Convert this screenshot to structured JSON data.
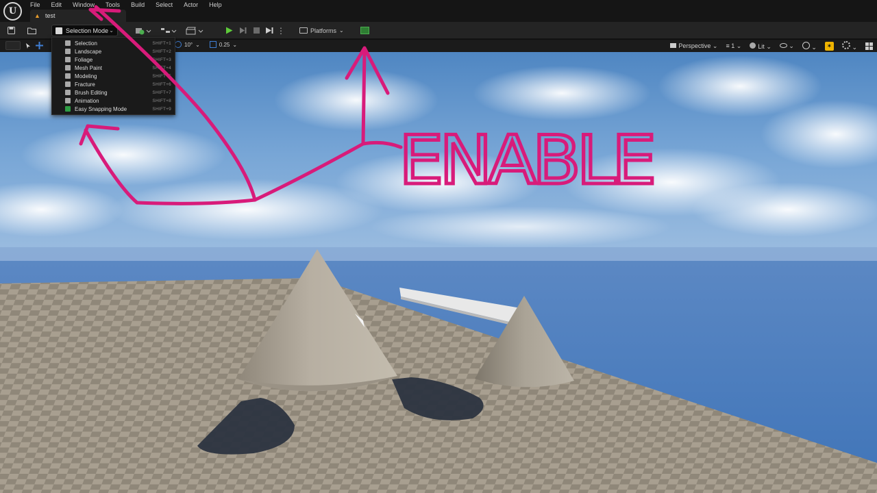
{
  "app": {
    "logo": "U",
    "menu": [
      "File",
      "Edit",
      "Window",
      "Tools",
      "Build",
      "Select",
      "Actor",
      "Help"
    ],
    "level_tab": "test"
  },
  "toolbar": {
    "mode_label": "Selection Mode",
    "platforms_label": "Platforms"
  },
  "viewport_bar": {
    "rotation_snap": "10°",
    "scale_snap": "0.25",
    "view_label": "Perspective",
    "camera_speed": "1",
    "view_mode": "Lit"
  },
  "mode_menu": {
    "items": [
      {
        "label": "Selection",
        "shortcut": "SHIFT+1",
        "icon": "selection-icon"
      },
      {
        "label": "Landscape",
        "shortcut": "SHIFT+2",
        "icon": "landscape-icon"
      },
      {
        "label": "Foliage",
        "shortcut": "SHIFT+3",
        "icon": "foliage-icon"
      },
      {
        "label": "Mesh Paint",
        "shortcut": "SHIFT+4",
        "icon": "mesh-paint-icon"
      },
      {
        "label": "Modeling",
        "shortcut": "SHIFT+5",
        "icon": "modeling-icon"
      },
      {
        "label": "Fracture",
        "shortcut": "SHIFT+6",
        "icon": "fracture-icon"
      },
      {
        "label": "Brush Editing",
        "shortcut": "SHIFT+7",
        "icon": "brush-editing-icon"
      },
      {
        "label": "Animation",
        "shortcut": "SHIFT+8",
        "icon": "animation-icon"
      },
      {
        "label": "Easy Snapping Mode",
        "shortcut": "SHIFT+9",
        "icon": "easy-snapping-icon"
      }
    ]
  },
  "annotation": {
    "text": "ENABLE",
    "color": "#d81b7a"
  },
  "colors": {
    "accent_play": "#5ecb3a",
    "highlight_yellow": "#f0b400",
    "snap_blue": "#3f7fd6"
  }
}
